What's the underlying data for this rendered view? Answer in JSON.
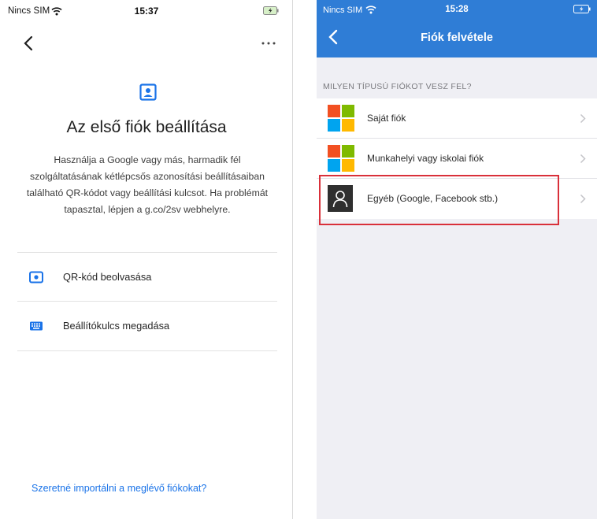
{
  "left_screen": {
    "status_bar": {
      "carrier": "Nincs SIM",
      "time": "15:37"
    },
    "title": "Az első fiók beállítása",
    "description": "Használja a Google vagy más, harmadik fél szolgáltatásának kétlépcsős azonosítási beállításaiban található QR-kódot vagy beállítási kulcsot. Ha problémát tapasztal, lépjen a g.co/2sv webhelyre.",
    "options": [
      {
        "label": "QR-kód beolvasása",
        "icon": "camera-icon"
      },
      {
        "label": "Beállítókulcs megadása",
        "icon": "keyboard-icon"
      }
    ],
    "import_link": "Szeretné importálni a meglévő fiókokat?",
    "colors": {
      "accent": "#1a73e8",
      "icon": "#1a73e8"
    }
  },
  "right_screen": {
    "status_bar": {
      "carrier": "Nincs SIM",
      "time": "15:28"
    },
    "header_title": "Fiók felvétele",
    "section_header": "MILYEN TÍPUSÚ FIÓKOT VESZ FEL?",
    "account_types": [
      {
        "label": "Saját fiók",
        "icon": "microsoft-logo-icon"
      },
      {
        "label": "Munkahelyi vagy iskolai fiók",
        "icon": "microsoft-logo-icon"
      },
      {
        "label": "Egyéb (Google, Facebook stb.)",
        "icon": "person-icon",
        "highlighted": true
      }
    ],
    "colors": {
      "header": "#2f7dd6",
      "highlight": "#d9303a",
      "ms_red": "#f25022",
      "ms_green": "#7fba00",
      "ms_blue": "#00a4ef",
      "ms_yellow": "#ffb900"
    }
  }
}
